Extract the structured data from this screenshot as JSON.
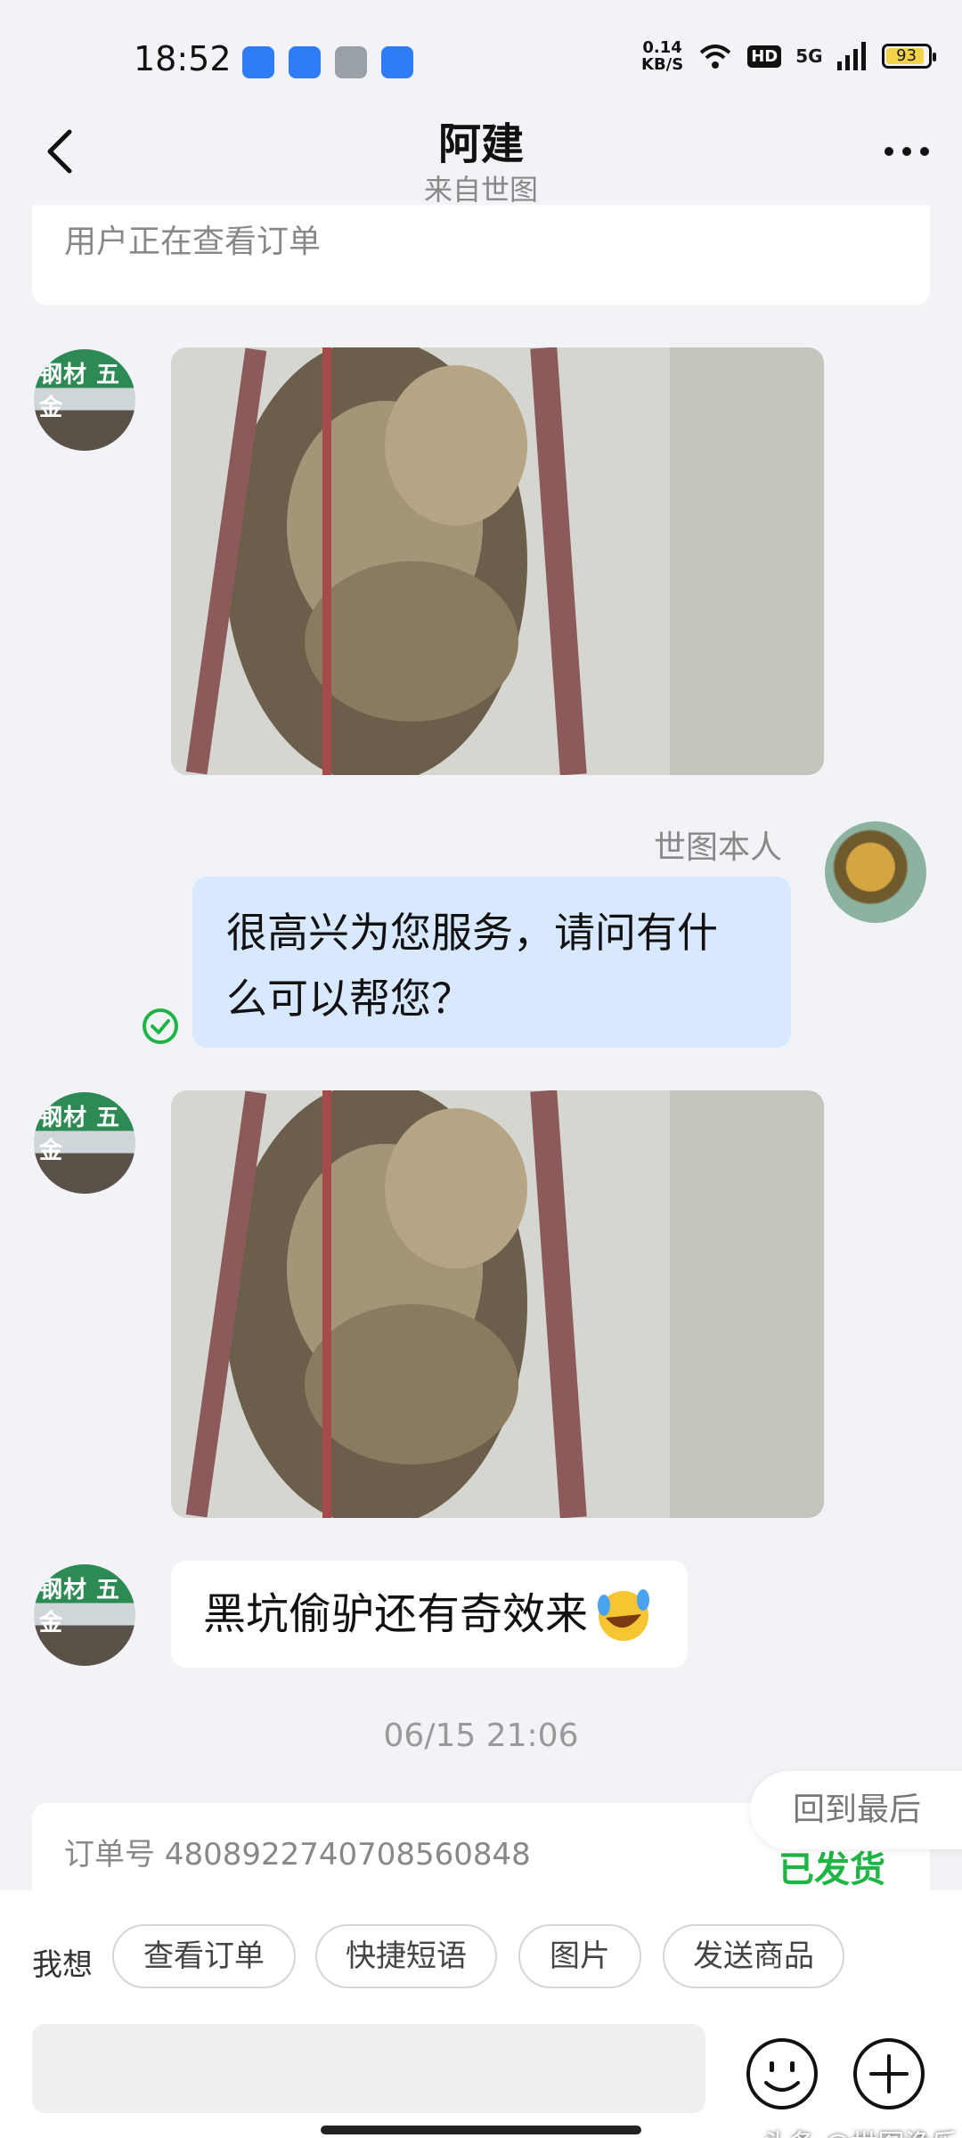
{
  "status_bar": {
    "time": "18:52",
    "speed_value": "0.14",
    "speed_unit": "KB/S",
    "hd": "HD",
    "network": "5G",
    "battery": "93"
  },
  "header": {
    "title": "阿建",
    "subtitle": "来自世图"
  },
  "top_card": {
    "text": "用户正在查看订单"
  },
  "messages": {
    "received_avatar_sign": "钢材 五金",
    "sent_sender_name": "世图本人",
    "sent_text": "很高兴为您服务，请问有什么可以帮您？",
    "received_text": "黑坑偷驴还有奇效来"
  },
  "timestamp": "06/15 21:06",
  "order": {
    "label": "订单号 4808922740708560848",
    "status": "已发货"
  },
  "goto_last": "回到最后",
  "quick_actions": {
    "prefix": "我想",
    "chips": [
      "查看订单",
      "快捷短语",
      "图片",
      "发送商品"
    ]
  },
  "watermark": "头条 @世图渔乐",
  "colors": {
    "sent_bubble": "#d8e8ff",
    "status_green": "#1fb545",
    "background": "#f1f3f6"
  },
  "icons": {
    "back": "chevron-left-icon",
    "more": "more-dots-icon",
    "check": "check-circle-icon",
    "emoji": "smiley-icon",
    "plus": "plus-circle-icon"
  }
}
